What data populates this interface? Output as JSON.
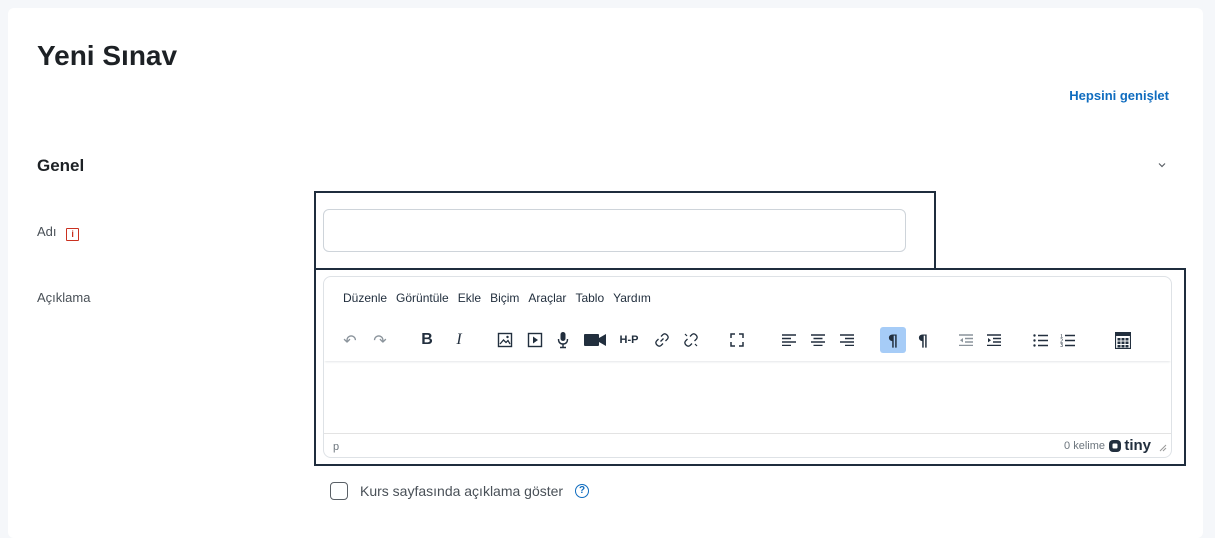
{
  "page": {
    "title": "Yeni Sınav",
    "expand_all": "Hepsini genişlet"
  },
  "section": {
    "title": "Genel",
    "toggle_icon": "chevron-down-icon"
  },
  "form": {
    "name_label": "Adı",
    "name_required_icon": "i",
    "name_value": "",
    "description_label": "Açıklama",
    "show_description_label": "Kurs sayfasında açıklama göster",
    "help_icon": "?"
  },
  "editor": {
    "menu": [
      "Düzenle",
      "Görüntüle",
      "Ekle",
      "Biçim",
      "Araçlar",
      "Tablo",
      "Yardım"
    ],
    "toolbar": {
      "undo": "↶",
      "redo": "↷",
      "bold": "B",
      "italic": "I",
      "image": "🖼",
      "media": "▶",
      "record_audio": "🎙",
      "record_video": "■",
      "h5p": "H-P",
      "link": "🔗",
      "unlink": "⛓",
      "fullscreen": "⛶",
      "align_left": "≡",
      "align_center": "≡",
      "align_right": "≡",
      "ltr": "¶",
      "rtl": "¶",
      "outdent": "⇤",
      "indent": "⇥",
      "bullet_list": "☰",
      "numbered_list": "☰",
      "calculator": "▦"
    },
    "path": "p",
    "word_count": "0 kelime",
    "brand": "tiny"
  },
  "colors": {
    "link": "#0f6cbf",
    "required": "#ca3120",
    "focus": "#1f2d3d",
    "active_button": "#a6ccf7"
  }
}
